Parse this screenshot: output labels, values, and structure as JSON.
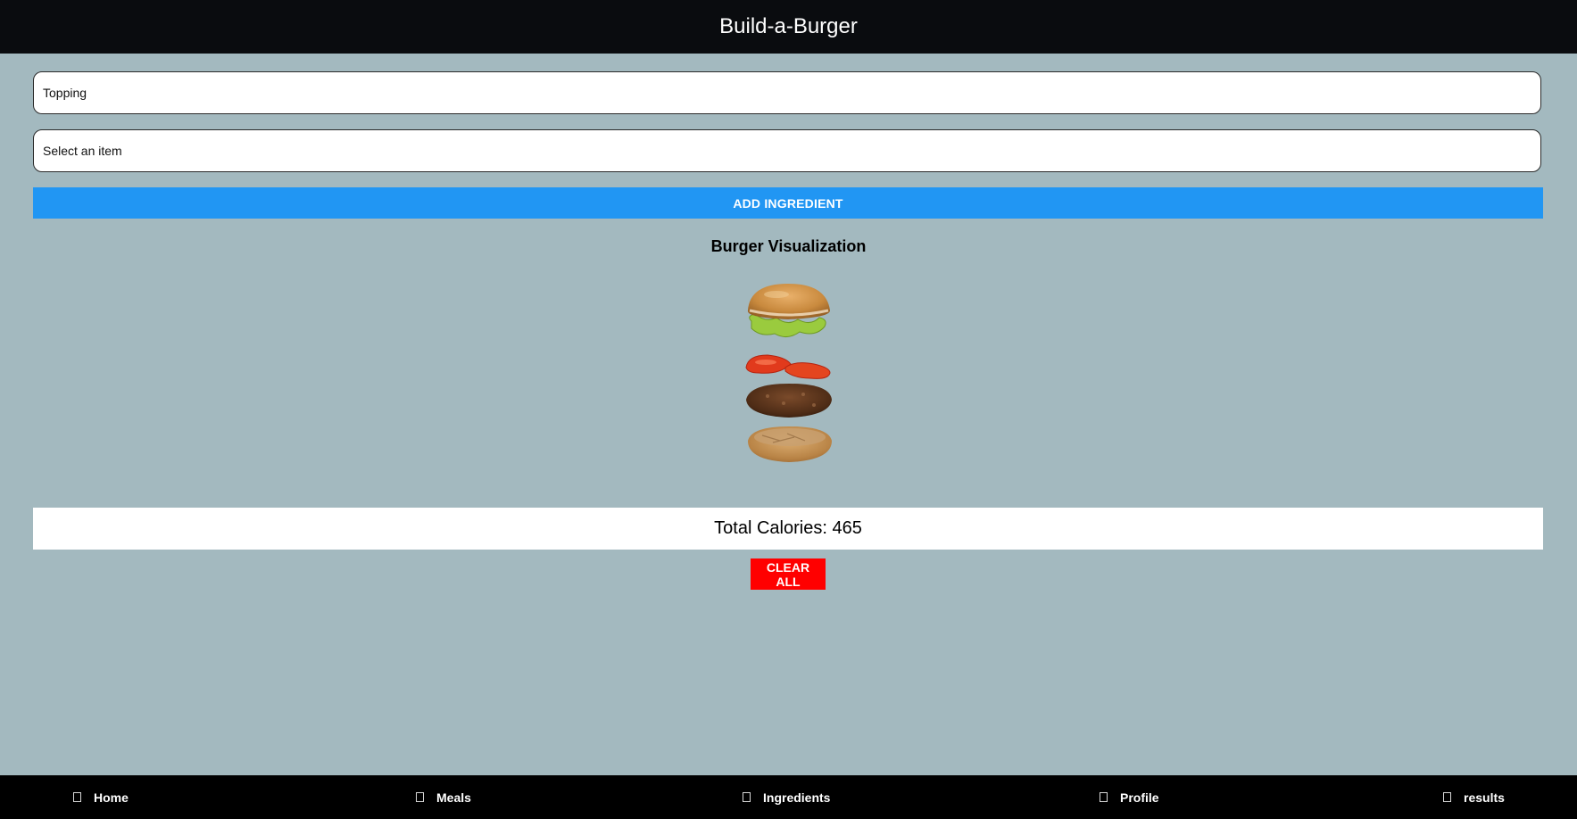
{
  "header": {
    "title": "Build-a-Burger"
  },
  "form": {
    "category_value": "Topping",
    "item_placeholder": "Select an item",
    "add_button_label": "ADD INGREDIENT"
  },
  "visualization": {
    "title": "Burger Visualization",
    "layers": [
      "top-bun-with-lettuce",
      "tomato-slices",
      "beef-patty",
      "bottom-bun"
    ]
  },
  "calories": {
    "label": "Total Calories:",
    "value": "465"
  },
  "clear_button_label": "CLEAR ALL",
  "colors": {
    "header_bg": "#0a0c0f",
    "page_bg": "#a3b9bf",
    "add_button": "#2196f3",
    "clear_button": "#ff0000"
  },
  "nav": {
    "items": [
      {
        "label": "Home",
        "icon": "home-icon"
      },
      {
        "label": "Meals",
        "icon": "meals-icon"
      },
      {
        "label": "Ingredients",
        "icon": "ingredients-icon"
      },
      {
        "label": "Profile",
        "icon": "profile-icon"
      },
      {
        "label": "results",
        "icon": "results-icon"
      }
    ]
  }
}
